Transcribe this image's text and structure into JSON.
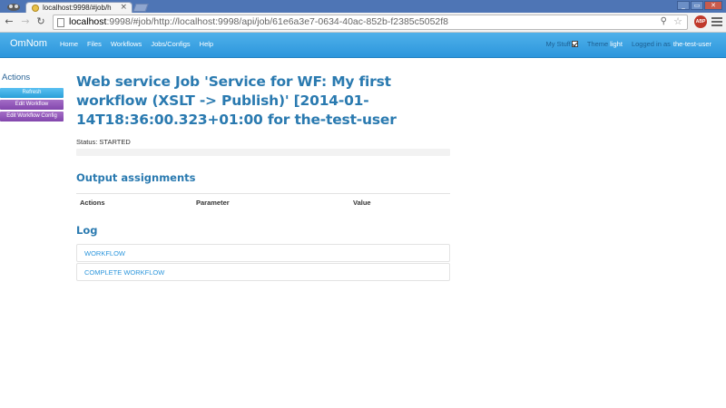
{
  "browser": {
    "tab_title": "localhost:9998/#job/h",
    "tab_close": "×",
    "url_host": "localhost",
    "url_rest": ":9998/#job/http://localhost:9998/api/job/61e6a3e7-0634-40ac-852b-f2385c5052f8",
    "window_buttons": [
      "_",
      "▭",
      "✕"
    ],
    "icons": [
      "back-arrow-icon",
      "forward-arrow-icon",
      "reload-icon",
      "page-icon",
      "zoom-icon",
      "star-icon",
      "adblock-icon",
      "menu-icon"
    ]
  },
  "navbar": {
    "brand": "OmNom",
    "links": [
      "Home",
      "Files",
      "Workflows",
      "Jobs/Configs",
      "Help"
    ],
    "my_stuff_label": "My Stuff",
    "my_stuff_checked": true,
    "theme_label": "Theme",
    "theme_value": "light",
    "logged_in_label": "Logged in as",
    "user": "the-test-user"
  },
  "sidebar": {
    "heading": "Actions",
    "buttons": [
      "Refresh",
      "Edit Workflow",
      "Edit Workflow Config"
    ]
  },
  "job": {
    "title": "Web service Job 'Service for WF: My first workflow (XSLT -> Publish)' [2014-01-14T18:36:00.323+01:00 for the-test-user",
    "status": "Status: STARTED",
    "progress": 0
  },
  "output_assignments": {
    "title": "Output assignments",
    "columns": [
      "Actions",
      "Parameter",
      "Value"
    ]
  },
  "log": {
    "title": "Log",
    "items": [
      "WORKFLOW",
      "COMPLETE WORKFLOW"
    ]
  },
  "colors": {
    "navbar": "#2c96dc",
    "title": "#2a7ab0",
    "purple_button": "#8246ad",
    "blue_button": "#2a9fd8"
  }
}
